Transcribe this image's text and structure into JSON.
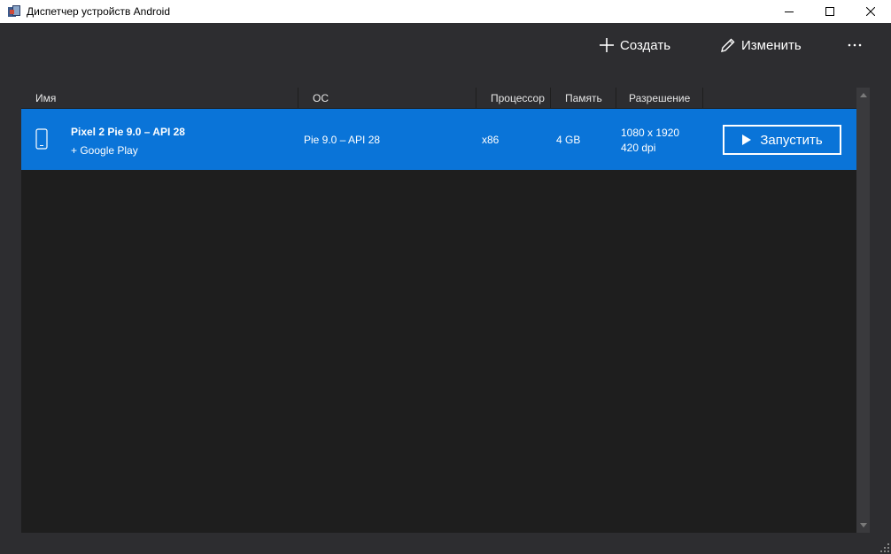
{
  "window": {
    "title": "Диспетчер устройств Android"
  },
  "toolbar": {
    "create_label": "Создать",
    "edit_label": "Изменить",
    "more_label": "···"
  },
  "table": {
    "columns": [
      "Имя",
      "ОС",
      "Процессор",
      "Память",
      "Разрешение"
    ],
    "rows": [
      {
        "name": "Pixel 2 Pie 9.0 – API 28",
        "subtitle": "+ Google Play",
        "os": "Pie 9.0 – API 28",
        "cpu": "x86",
        "memory": "4 GB",
        "resolution": "1080 x 1920",
        "density": "420 dpi",
        "launch_label": "Запустить"
      }
    ]
  },
  "colors": {
    "selected_row": "#0a74d8",
    "background": "#2d2d30",
    "list_background": "#1e1e1e"
  }
}
